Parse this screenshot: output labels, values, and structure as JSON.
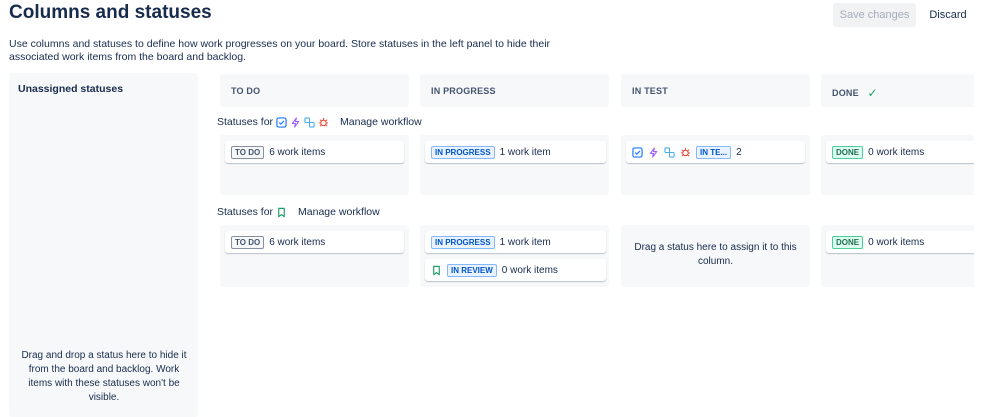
{
  "header": {
    "title": "Columns and statuses",
    "save_label": "Save changes",
    "discard_label": "Discard"
  },
  "description": "Use columns and statuses to define how work progresses on your board. Store statuses in the left panel to hide their associated work items from the board and backlog.",
  "unassigned": {
    "title": "Unassigned statuses",
    "hint": "Drag and drop a status here to hide it from the board and backlog. Work items with these statuses won't be visible."
  },
  "columns": [
    {
      "label": "TO DO"
    },
    {
      "label": "IN PROGRESS"
    },
    {
      "label": "IN TEST"
    },
    {
      "label": "DONE"
    }
  ],
  "workflows": [
    {
      "statuses_for_label": "Statuses for",
      "manage_label": "Manage workflow",
      "icons": [
        "task-icon",
        "epic-icon",
        "subtask-icon",
        "bug-icon"
      ],
      "cells": [
        {
          "cards": [
            {
              "status": "TO DO",
              "count": "6 work items"
            }
          ]
        },
        {
          "cards": [
            {
              "status": "IN PROGRESS",
              "count": "1 work item"
            }
          ]
        },
        {
          "cards": [
            {
              "status": "IN TE...",
              "count": "2"
            }
          ]
        },
        {
          "cards": [
            {
              "status": "DONE",
              "count": "0 work items"
            }
          ]
        }
      ]
    },
    {
      "statuses_for_label": "Statuses for",
      "manage_label": "Manage workflow",
      "icons": [
        "story-icon"
      ],
      "cells": [
        {
          "cards": [
            {
              "status": "TO DO",
              "count": "6 work items"
            }
          ]
        },
        {
          "cards": [
            {
              "status": "IN PROGRESS",
              "count": "1 work item"
            },
            {
              "status": "IN REVIEW",
              "count": "0 work items"
            }
          ]
        },
        {
          "drop_hint": "Drag a status here to assign it to this column."
        },
        {
          "cards": [
            {
              "status": "DONE",
              "count": "0 work items"
            }
          ]
        }
      ]
    }
  ],
  "colors": {
    "task": "#1d7afc",
    "epic": "#9f5fff",
    "subtask": "#4bade8",
    "bug": "#e34935",
    "story": "#22a06b",
    "done_check": "#22a06b"
  }
}
